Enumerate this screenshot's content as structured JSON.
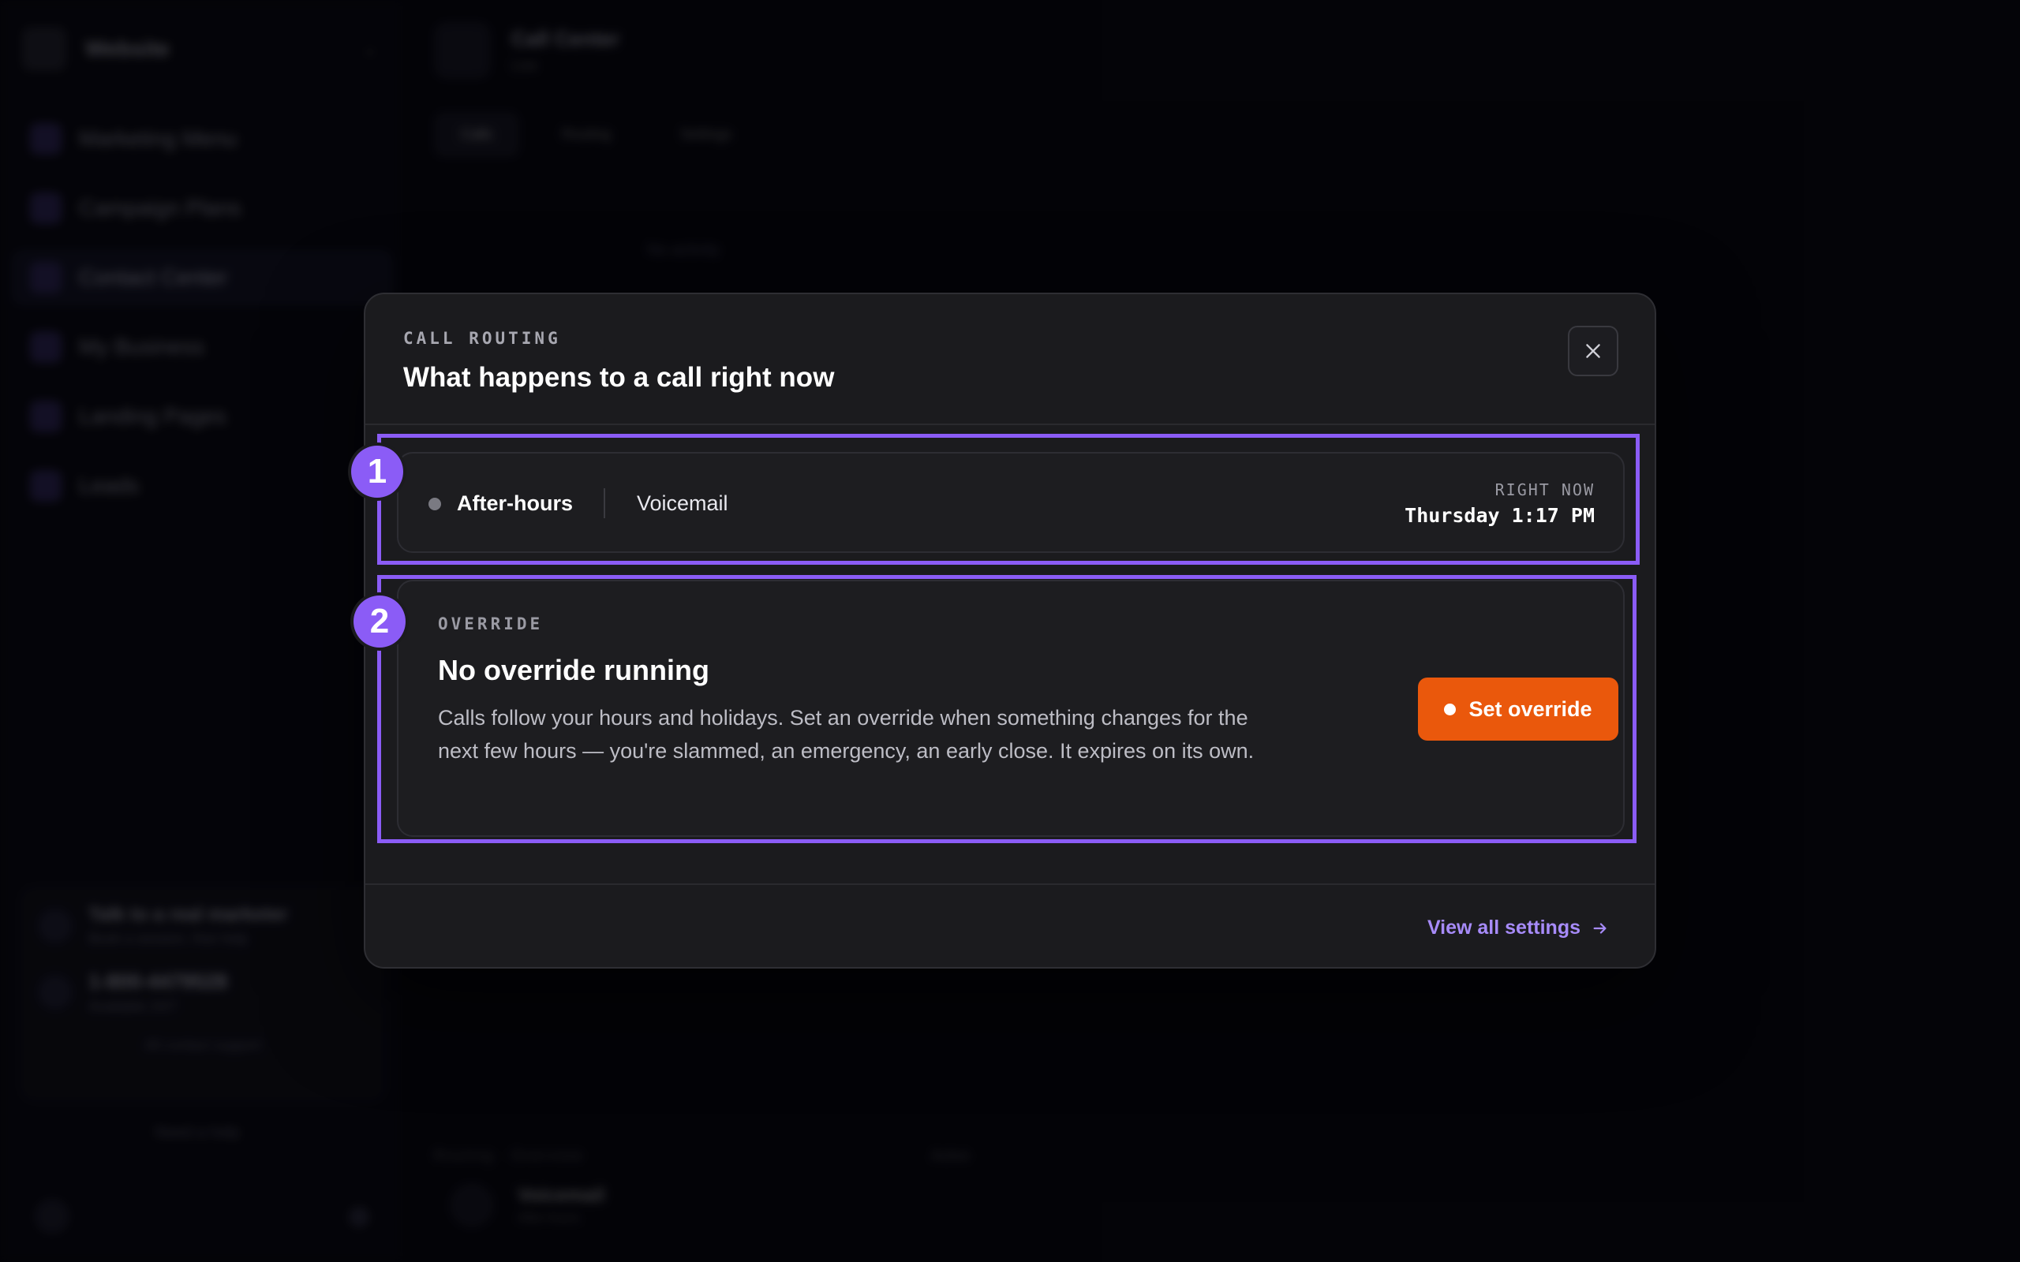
{
  "background": {
    "workspace_name": "Website",
    "nav": [
      {
        "label": "Marketing Menu",
        "active": false
      },
      {
        "label": "Campaign Plans",
        "active": false
      },
      {
        "label": "Contact Center",
        "active": true
      },
      {
        "label": "My Business",
        "active": false
      },
      {
        "label": "Landing Pages",
        "active": false
      },
      {
        "label": "Leads",
        "active": false
      }
    ],
    "promo": {
      "title": "Talk to a real marketer",
      "subtitle": "Book a session, free help",
      "number": "1-800-4479528",
      "number_sub": "Available 24/7",
      "link": "All contact support"
    },
    "sidebar_footer": "Need a help",
    "main": {
      "title": "Call Center",
      "subtitle": "Live",
      "tabs": [
        "Calls",
        "Routing",
        "Settings"
      ],
      "empty": "No activity",
      "bottom_left": "Routing · Overview",
      "bottom_right": "Active",
      "voicemail_title": "Voicemail",
      "voicemail_sub": "After-hours"
    }
  },
  "modal": {
    "eyebrow": "CALL ROUTING",
    "title": "What happens to a call right now",
    "close_icon": "close-icon",
    "status": {
      "mode": "After-hours",
      "destination": "Voicemail",
      "right_now_label": "RIGHT NOW",
      "right_now_time": "Thursday 1:17 PM",
      "dot_color": "#7a7a82"
    },
    "override": {
      "eyebrow": "OVERRIDE",
      "title": "No override running",
      "description": "Calls follow your hours and holidays. Set an override when something changes for the next few hours — you're slammed, an emergency, an early close. It expires on its own.",
      "button_label": "Set override",
      "button_color": "#ea580c"
    },
    "footer_link": "View all settings",
    "footer_link_icon": "arrow-right-icon",
    "accent": "#a78bfa"
  },
  "annotations": {
    "badge_1": "1",
    "badge_2": "2",
    "color": "#8b5cf6"
  }
}
